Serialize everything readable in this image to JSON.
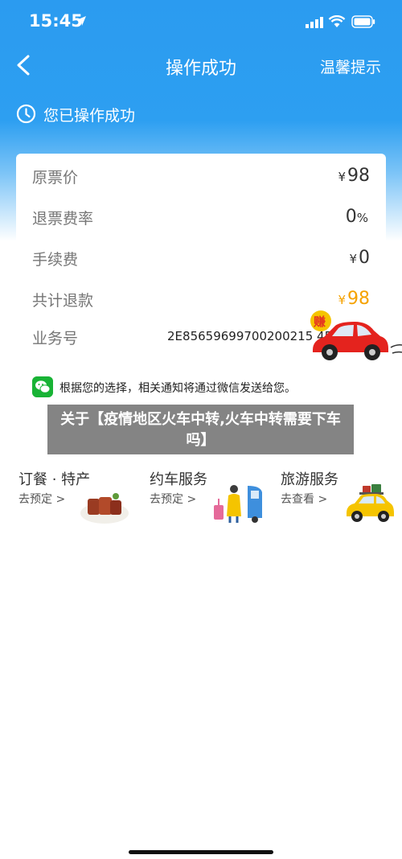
{
  "status_bar": {
    "time": "15:45"
  },
  "nav": {
    "title": "操作成功",
    "right_label": "温馨提示"
  },
  "success_message": "您已操作成功",
  "refund": {
    "rows": [
      {
        "label": "原票价",
        "currency": "¥",
        "value": "98"
      },
      {
        "label": "退票费率",
        "currency": "",
        "value": "0",
        "unit": "%"
      },
      {
        "label": "手续费",
        "currency": "¥",
        "value": "0"
      },
      {
        "label": "共计退款",
        "currency": "¥",
        "value": "98"
      }
    ],
    "business_label": "业务号",
    "business_number": "2E85659699700200215 45",
    "wechat_note": "根据您的选择，相关通知将通过微信发送给您。"
  },
  "decoration": {
    "stamp_text": "赚"
  },
  "overlay_title": "关于【疫情地区火车中转,火车中转需要下车吗】",
  "services": [
    {
      "title": "订餐 · 特产",
      "sub": "去预定 >"
    },
    {
      "title": "约车服务",
      "sub": "去预定 >"
    },
    {
      "title": "旅游服务",
      "sub": "去查看 >"
    }
  ],
  "colors": {
    "header_blue": "#2b9bf0",
    "refund_total": "#f5a200",
    "wechat_green": "#18b335"
  }
}
